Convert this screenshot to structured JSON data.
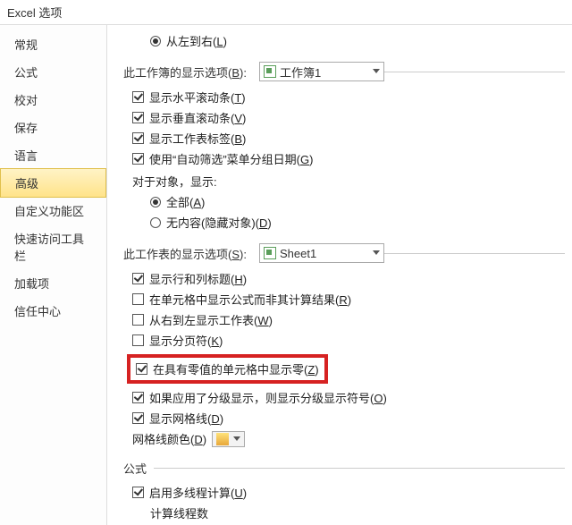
{
  "title": "Excel 选项",
  "sidebar": {
    "items": [
      {
        "label": "常规"
      },
      {
        "label": "公式"
      },
      {
        "label": "校对"
      },
      {
        "label": "保存"
      },
      {
        "label": "语言"
      },
      {
        "label": "高级",
        "selected": true
      },
      {
        "label": "自定义功能区"
      },
      {
        "label": "快速访问工具栏"
      },
      {
        "label": "加载项"
      },
      {
        "label": "信任中心"
      }
    ]
  },
  "direction": {
    "ltr_label": "从左到右(",
    "ltr_hotkey": "L",
    "close": ")"
  },
  "workbook_section": {
    "title": "此工作簿的显示选项(",
    "hotkey": "B",
    "close": "):",
    "value": "工作簿1"
  },
  "workbook_opts": {
    "hscroll": {
      "label": "显示水平滚动条(",
      "hotkey": "T",
      "close": ")",
      "checked": true
    },
    "vscroll": {
      "label": "显示垂直滚动条(",
      "hotkey": "V",
      "close": ")",
      "checked": true
    },
    "tabs": {
      "label": "显示工作表标签(",
      "hotkey": "B",
      "close": ")",
      "checked": true
    },
    "autofilter": {
      "label": "使用“自动筛选”菜单分组日期(",
      "hotkey": "G",
      "close": ")",
      "checked": true
    },
    "objects_label": "对于对象，显示:",
    "all": {
      "label": "全部(",
      "hotkey": "A",
      "close": ")",
      "checked": true
    },
    "nothing": {
      "label": "无内容(隐藏对象)(",
      "hotkey": "D",
      "close": ")",
      "checked": false
    }
  },
  "sheet_section": {
    "title": "此工作表的显示选项(",
    "hotkey": "S",
    "close": "):",
    "value": "Sheet1"
  },
  "sheet_opts": {
    "headers": {
      "label": "显示行和列标题(",
      "hotkey": "H",
      "close": ")",
      "checked": true
    },
    "formulas": {
      "label": "在单元格中显示公式而非其计算结果(",
      "hotkey": "R",
      "close": ")",
      "checked": false
    },
    "rtl": {
      "label": "从右到左显示工作表(",
      "hotkey": "W",
      "close": ")",
      "checked": false
    },
    "pagebreaks": {
      "label": "显示分页符(",
      "hotkey": "K",
      "close": ")",
      "checked": false
    },
    "zeros": {
      "label": "在具有零值的单元格中显示零(",
      "hotkey": "Z",
      "close": ")",
      "checked": true
    },
    "outline": {
      "label": "如果应用了分级显示，则显示分级显示符号(",
      "hotkey": "O",
      "close": ")",
      "checked": true
    },
    "gridlines": {
      "label": "显示网格线(",
      "hotkey": "D",
      "close": ")",
      "checked": true
    },
    "gridcolor_label": "网格线颜色(",
    "gridcolor_hotkey": "D",
    "gridcolor_close": ")"
  },
  "formula_section": {
    "title": "公式",
    "multithread": {
      "label": "启用多线程计算(",
      "hotkey": "U",
      "close": ")",
      "checked": true
    },
    "threads_label": "计算线程数"
  }
}
